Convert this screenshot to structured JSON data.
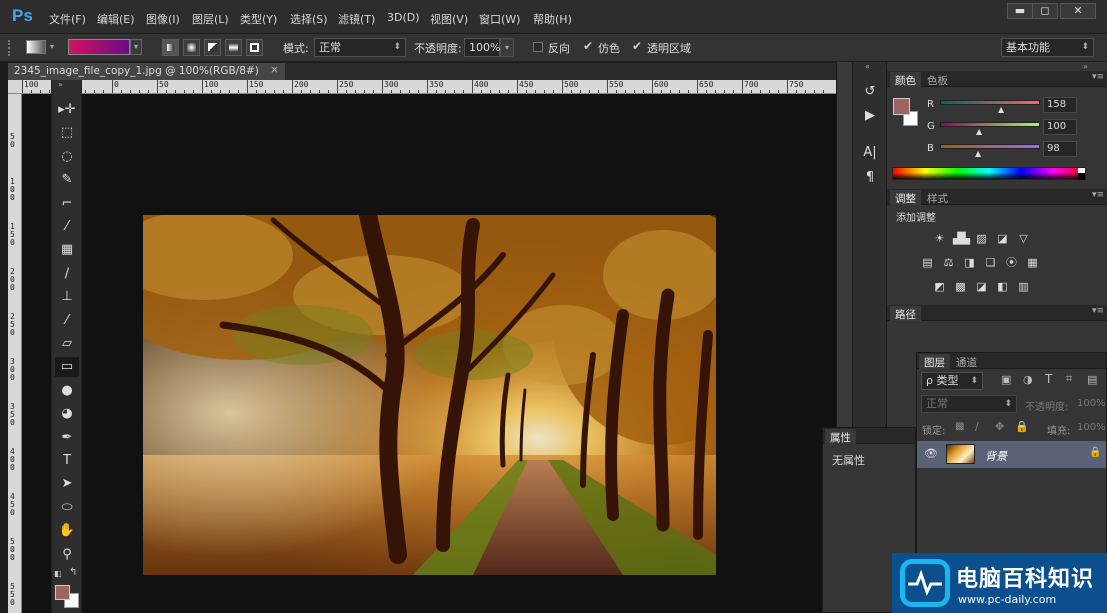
{
  "app": {
    "logo": "Ps"
  },
  "menu": {
    "items": [
      "文件(F)",
      "编辑(E)",
      "图像(I)",
      "图层(L)",
      "类型(Y)",
      "选择(S)",
      "滤镜(T)",
      "3D(D)",
      "视图(V)",
      "窗口(W)",
      "帮助(H)"
    ]
  },
  "window_controls": {
    "minimize": "▬",
    "maximize": "◻",
    "close": "✕"
  },
  "options": {
    "mode_label": "模式:",
    "mode_value": "正常",
    "opacity_label": "不透明度:",
    "opacity_value": "100%",
    "reverse_label": "反向",
    "dither_label": "仿色",
    "transparency_label": "透明区域",
    "workspace": "基本功能",
    "gradient_start": "#d2135f",
    "gradient_end": "#6a0a86"
  },
  "document": {
    "tab_title": "2345_image_file_copy_1.jpg @ 100%(RGB/8#)",
    "close_symbol": "×"
  },
  "ruler": {
    "h_labels": [
      "100",
      "50",
      "0",
      "50",
      "100",
      "150",
      "200",
      "250",
      "300",
      "350",
      "400",
      "450",
      "500",
      "550",
      "600",
      "650",
      "700",
      "750"
    ],
    "v_labels": [
      "0",
      "5\n0",
      "1\n0\n0",
      "1\n5\n0",
      "2\n0\n0",
      "2\n5\n0",
      "3\n0\n0",
      "3\n5\n0",
      "4\n0\n0",
      "4\n5\n0",
      "5\n0\n0",
      "5\n5\n0"
    ]
  },
  "tools": [
    {
      "icon": "move-icon",
      "glyph": "▸✛"
    },
    {
      "icon": "marquee-icon",
      "glyph": "⬚"
    },
    {
      "icon": "lasso-icon",
      "glyph": "◌"
    },
    {
      "icon": "quick-select-icon",
      "glyph": "✎"
    },
    {
      "icon": "crop-icon",
      "glyph": "⌐"
    },
    {
      "icon": "eyedropper-icon",
      "glyph": "⁄"
    },
    {
      "icon": "healing-brush-icon",
      "glyph": "▦"
    },
    {
      "icon": "brush-icon",
      "glyph": "∕"
    },
    {
      "icon": "clone-stamp-icon",
      "glyph": "⊥"
    },
    {
      "icon": "history-brush-icon",
      "glyph": "⁄"
    },
    {
      "icon": "eraser-icon",
      "glyph": "▱"
    },
    {
      "icon": "gradient-icon",
      "glyph": "▭"
    },
    {
      "icon": "blur-icon",
      "glyph": "●"
    },
    {
      "icon": "dodge-icon",
      "glyph": "◕"
    },
    {
      "icon": "pen-icon",
      "glyph": "✒"
    },
    {
      "icon": "type-icon",
      "glyph": "T"
    },
    {
      "icon": "path-select-icon",
      "glyph": "➤"
    },
    {
      "icon": "ellipse-icon",
      "glyph": "⬭"
    },
    {
      "icon": "hand-icon",
      "glyph": "✋"
    },
    {
      "icon": "zoom-icon",
      "glyph": "⚲"
    }
  ],
  "colors": {
    "foreground": "#9e6462",
    "background": "#ffffff",
    "accent": "#4aa3e8"
  },
  "collapsed_panel": {
    "buttons": [
      {
        "icon": "history-icon",
        "glyph": "↺"
      },
      {
        "icon": "actions-icon",
        "glyph": "▶"
      },
      {
        "icon": "character-icon",
        "glyph": "A|"
      },
      {
        "icon": "paragraph-icon",
        "glyph": "¶"
      }
    ]
  },
  "color_panel": {
    "tabs": [
      "颜色",
      "色板"
    ],
    "r_label": "R",
    "g_label": "G",
    "b_label": "B",
    "r": "158",
    "g": "100",
    "b": "98"
  },
  "adjustments_panel": {
    "tabs": [
      "调整",
      "样式"
    ],
    "title": "添加调整",
    "rows": [
      [
        "brightness-icon",
        "levels-icon",
        "curves-icon",
        "exposure-icon",
        "vibrance-icon"
      ],
      [
        "hue-saturation-icon",
        "color-balance-icon",
        "black-white-icon",
        "photo-filter-icon",
        "channel-mixer-icon",
        "color-lookup-icon"
      ],
      [
        "invert-icon",
        "posterize-icon",
        "threshold-icon",
        "selective-color-icon",
        "gradient-map-icon"
      ]
    ],
    "glyphs": [
      [
        "☀",
        "▟▙",
        "▨",
        "◪",
        "▽"
      ],
      [
        "▤",
        "⚖",
        "◨",
        "❏",
        "⦿",
        "▦"
      ],
      [
        "◩",
        "▩",
        "◪",
        "◧",
        "▥"
      ]
    ]
  },
  "paths_panel": {
    "tabs": [
      "路径"
    ]
  },
  "properties_panel": {
    "tabs": [
      "属性"
    ],
    "content": "无属性"
  },
  "layers_panel": {
    "tabs": [
      "图层",
      "通道"
    ],
    "filter_label": "ρ 类型",
    "blend_mode": "正常",
    "opacity_label": "不透明度:",
    "opacity_value": "100%",
    "lock_label": "锁定:",
    "fill_label": "填充:",
    "fill_value": "100%",
    "layers": [
      {
        "name": "背景"
      }
    ]
  },
  "watermark": {
    "brand": "电脑百科知识",
    "url": "www.pc-daily.com"
  }
}
